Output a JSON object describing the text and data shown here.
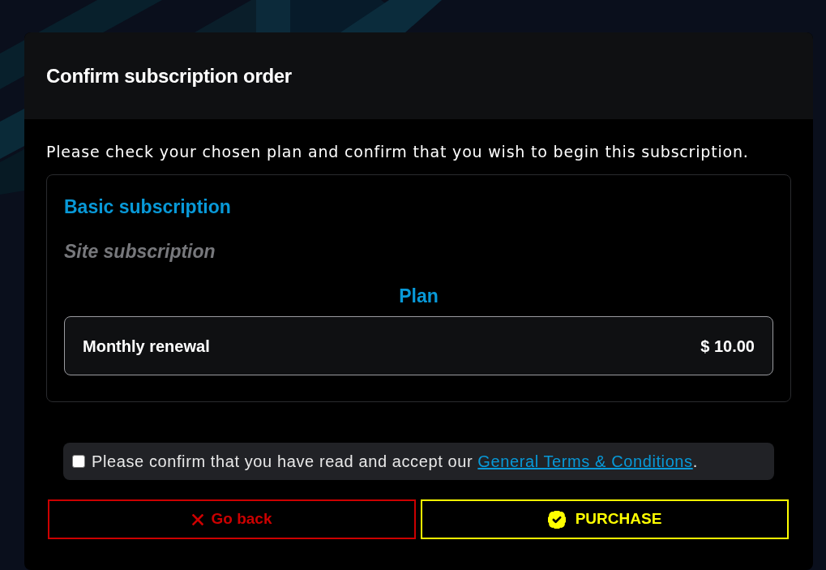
{
  "dialog": {
    "title": "Confirm subscription order",
    "intro": "Please check your chosen plan and confirm that you wish to begin this subscription.",
    "product": {
      "name": "Basic subscription",
      "type": "Site subscription"
    },
    "plan": {
      "heading": "Plan",
      "name": "Monthly renewal",
      "price": "$ 10.00"
    },
    "terms": {
      "checked": false,
      "text": "Please confirm that you have read and accept our ",
      "link": "General Terms & Conditions",
      "suffix": "."
    },
    "buttons": [
      {
        "kind": "cancel",
        "label": "Go back"
      },
      {
        "kind": "confirm",
        "label": "PURCHASE"
      }
    ]
  }
}
